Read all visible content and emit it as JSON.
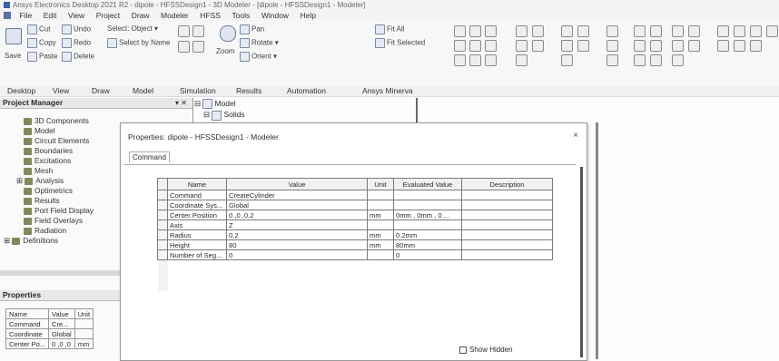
{
  "window": {
    "title": "Ansys Electronics Desktop 2021 R2 - dipole - HFSSDesign1 - 3D Modeler - [dipole - HFSSDesign1 - Modeler]"
  },
  "menu": [
    "File",
    "Edit",
    "View",
    "Project",
    "Draw",
    "Modeler",
    "HFSS",
    "Tools",
    "Window",
    "Help"
  ],
  "ribbon": {
    "save": "Save",
    "cut": "Cut",
    "copy": "Copy",
    "paste": "Paste",
    "undo": "Undo",
    "redo": "Redo",
    "delete": "Delete",
    "select_object": "Select: Object",
    "select_by_name": "Select by Name",
    "zoom": "Zoom",
    "pan": "Pan",
    "rotate": "Rotate",
    "orient": "Orient",
    "fit_all": "Fit All",
    "fit_selected": "Fit Selected"
  },
  "ribbon_tabs": [
    "Desktop",
    "View",
    "Draw",
    "Model",
    "Simulation",
    "Results",
    "Automation",
    "Ansys Minerva"
  ],
  "project_manager": {
    "title": "Project Manager",
    "controls": "▾ ✕",
    "items": [
      "3D Components",
      "Model",
      "Circuit Elements",
      "Boundaries",
      "Excitations",
      "Mesh",
      "Analysis",
      "Optimetrics",
      "Results",
      "Port Field Display",
      "Field Overlays",
      "Radiation",
      "Definitions"
    ]
  },
  "model_tree": {
    "root": "Model",
    "child": "Solids"
  },
  "properties_panel": {
    "title": "Properties",
    "headers": [
      "Name",
      "Value",
      "Unit"
    ],
    "rows": [
      [
        "Command",
        "Cre...",
        ""
      ],
      [
        "Coordinate",
        "Global",
        ""
      ],
      [
        "Center Po...",
        "0 ,0 ,0",
        "mm"
      ]
    ]
  },
  "dialog": {
    "title": "Properties: dipole - HFSSDesign1 - Modeler",
    "close": "×",
    "tab": "Command",
    "headers": [
      "Name",
      "Value",
      "Unit",
      "Evaluated Value",
      "Description"
    ],
    "rows": [
      [
        "Command",
        "CreateCylinder",
        "",
        "",
        ""
      ],
      [
        "Coordinate Sys...",
        "Global",
        "",
        "",
        ""
      ],
      [
        "Center Position",
        "0 ,0 ,0.2",
        "mm",
        "0mm , 0mm , 0 ...",
        ""
      ],
      [
        "Axis",
        "Z",
        "",
        "",
        ""
      ],
      [
        "Radius",
        "0.2",
        "mm",
        "0.2mm",
        ""
      ],
      [
        "Height",
        "80",
        "mm",
        "80mm",
        ""
      ],
      [
        "Number of Seg...",
        "0",
        "",
        "0",
        ""
      ]
    ],
    "show_hidden": "Show Hidden"
  }
}
